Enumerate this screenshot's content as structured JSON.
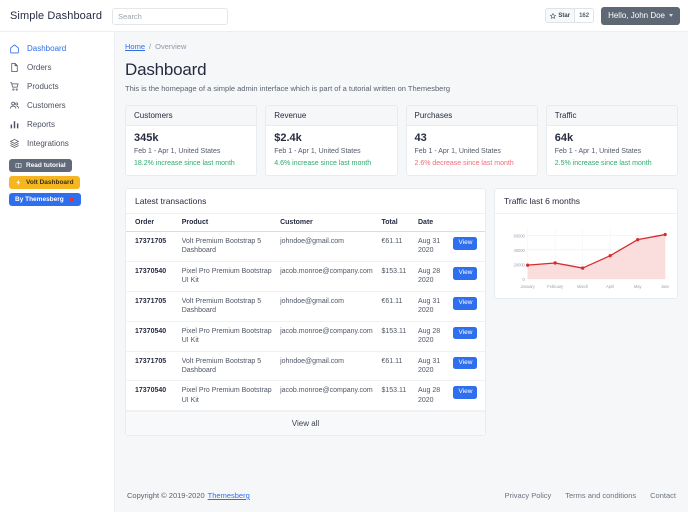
{
  "topbar": {
    "brand": "Simple Dashboard",
    "search_placeholder": "Search",
    "search_value": "",
    "star_label": "Star",
    "star_count": "162",
    "user_label": "Hello, John Doe"
  },
  "sidebar": {
    "items": [
      {
        "label": "Dashboard",
        "icon": "home-icon"
      },
      {
        "label": "Orders",
        "icon": "document-icon"
      },
      {
        "label": "Products",
        "icon": "cart-icon"
      },
      {
        "label": "Customers",
        "icon": "people-icon"
      },
      {
        "label": "Reports",
        "icon": "bar-chart-icon"
      },
      {
        "label": "Integrations",
        "icon": "layers-icon"
      }
    ],
    "badges": {
      "tutorial": "Read tutorial",
      "volt": "Volt Dashboard",
      "themesberg": "By Themesberg"
    }
  },
  "breadcrumb": {
    "home": "Home",
    "separator": "/",
    "current": "Overview"
  },
  "page": {
    "title": "Dashboard",
    "subtitle": "This is the homepage of a simple admin interface which is part of a tutorial written on Themesberg"
  },
  "stats": [
    {
      "title": "Customers",
      "value": "345k",
      "meta": "Feb 1 - Apr 1, United States",
      "delta": "18.2% increase since last month",
      "delta_color": "#2bab6e"
    },
    {
      "title": "Revenue",
      "value": "$2.4k",
      "meta": "Feb 1 - Apr 1, United States",
      "delta": "4.6% increase since last month",
      "delta_color": "#2bab6e"
    },
    {
      "title": "Purchases",
      "value": "43",
      "meta": "Feb 1 - Apr 1, United States",
      "delta": "2.6% decrease since last month",
      "delta_color": "#f06b7a"
    },
    {
      "title": "Traffic",
      "value": "64k",
      "meta": "Feb 1 - Apr 1, United States",
      "delta": "2.5% increase since last month",
      "delta_color": "#2bab6e"
    }
  ],
  "transactions": {
    "title": "Latest transactions",
    "columns": [
      "Order",
      "Product",
      "Customer",
      "Total",
      "Date",
      ""
    ],
    "action_label": "View",
    "view_all": "View all",
    "rows": [
      {
        "order": "17371705",
        "product": "Volt Premium Bootstrap 5 Dashboard",
        "customer": "johndoe@gmail.com",
        "total": "€61.11",
        "date": "Aug 31 2020"
      },
      {
        "order": "17370540",
        "product": "Pixel Pro Premium Bootstrap UI Kit",
        "customer": "jacob.monroe@company.com",
        "total": "$153.11",
        "date": "Aug 28 2020"
      },
      {
        "order": "17371705",
        "product": "Volt Premium Bootstrap 5 Dashboard",
        "customer": "johndoe@gmail.com",
        "total": "€61.11",
        "date": "Aug 31 2020"
      },
      {
        "order": "17370540",
        "product": "Pixel Pro Premium Bootstrap UI Kit",
        "customer": "jacob.monroe@company.com",
        "total": "$153.11",
        "date": "Aug 28 2020"
      },
      {
        "order": "17371705",
        "product": "Volt Premium Bootstrap 5 Dashboard",
        "customer": "johndoe@gmail.com",
        "total": "€61.11",
        "date": "Aug 31 2020"
      },
      {
        "order": "17370540",
        "product": "Pixel Pro Premium Bootstrap UI Kit",
        "customer": "jacob.monroe@company.com",
        "total": "$153.11",
        "date": "Aug 28 2020"
      }
    ]
  },
  "traffic_panel": {
    "title": "Traffic last 6 months"
  },
  "chart_data": {
    "type": "line",
    "title": "Traffic last 6 months",
    "categories": [
      "January",
      "February",
      "March",
      "April",
      "May",
      "June"
    ],
    "values": [
      19000,
      22000,
      15000,
      32000,
      54000,
      61000
    ],
    "series": [
      {
        "name": "Traffic",
        "values": [
          19000,
          22000,
          15000,
          32000,
          54000,
          61000
        ]
      }
    ],
    "yticks": [
      0,
      20000,
      40000,
      60000
    ],
    "ylim": [
      0,
      70000
    ],
    "xlabel": "",
    "ylabel": "",
    "grid": true,
    "legend": "none",
    "line_color": "#d92b2b",
    "fill_color": "#fadddd",
    "marker": "circle"
  },
  "footer": {
    "copyright": "Copyright © 2019-2020",
    "brand_link": "Themesberg",
    "links": [
      "Privacy Policy",
      "Terms and conditions",
      "Contact"
    ]
  }
}
